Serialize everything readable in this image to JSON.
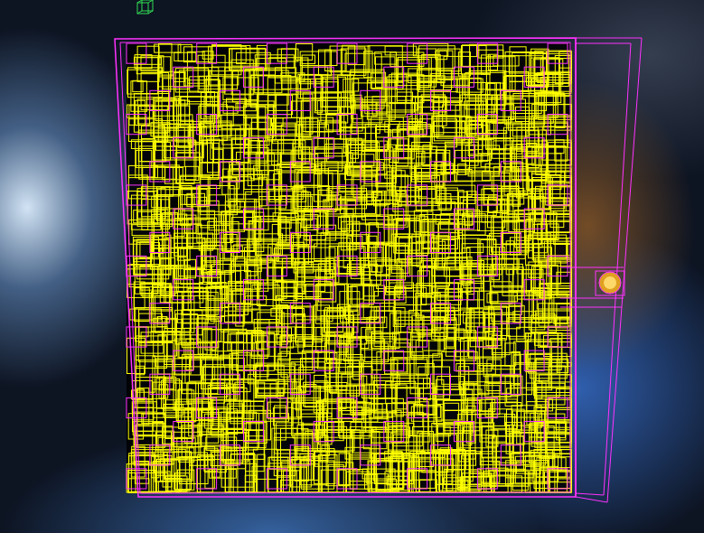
{
  "viewport": {
    "mode": "wireframe"
  },
  "box_groups": [
    {
      "kind": "outer",
      "color": "#ff33ff"
    },
    {
      "kind": "inner",
      "color": "#ffff00"
    }
  ]
}
